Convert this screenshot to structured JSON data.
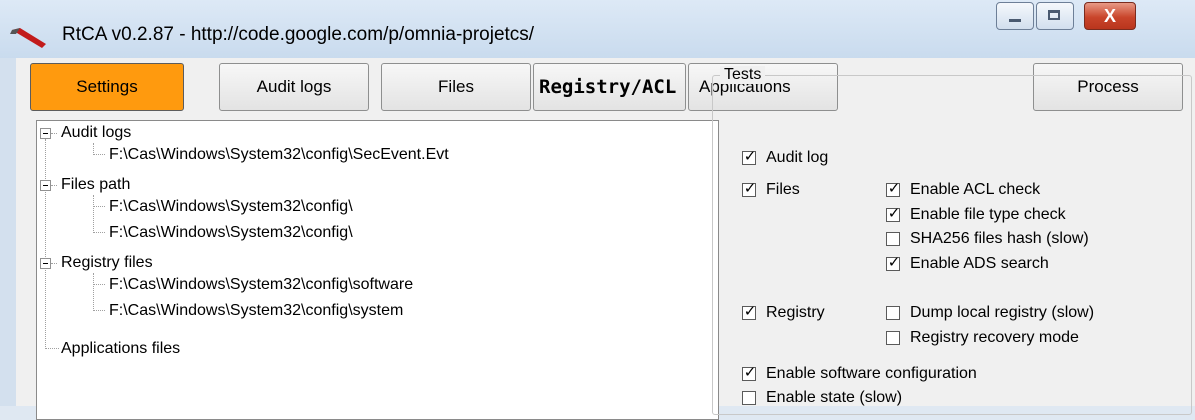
{
  "window": {
    "title": "RtCA v0.2.87 - http://code.google.com/p/omnia-projetcs/",
    "close_glyph": "X"
  },
  "tabs": [
    {
      "label": "Settings",
      "active": true
    },
    {
      "label": "Audit logs",
      "active": false
    },
    {
      "label": "Files",
      "active": false
    },
    {
      "label": "Registry/ACL",
      "active": false
    },
    {
      "label": "Applications",
      "active": false
    },
    {
      "label": "Process",
      "active": false
    }
  ],
  "tree": {
    "audit_logs": {
      "label": "Audit logs",
      "children": [
        "F:\\Cas\\Windows\\System32\\config\\SecEvent.Evt"
      ]
    },
    "files_path": {
      "label": "Files path",
      "children": [
        "F:\\Cas\\Windows\\System32\\config\\",
        "F:\\Cas\\Windows\\System32\\config\\"
      ]
    },
    "registry_files": {
      "label": "Registry files",
      "children": [
        "F:\\Cas\\Windows\\System32\\config\\software",
        "F:\\Cas\\Windows\\System32\\config\\system"
      ]
    },
    "applications_files": {
      "label": "Applications files"
    }
  },
  "tests": {
    "legend": "Tests",
    "audit_log": {
      "label": "Audit log",
      "checked": true
    },
    "files": {
      "label": "Files",
      "checked": true
    },
    "enable_acl_check": {
      "label": "Enable ACL check",
      "checked": true
    },
    "enable_file_type_check": {
      "label": "Enable file type check",
      "checked": true
    },
    "sha256_files_hash": {
      "label": "SHA256 files hash (slow)",
      "checked": false
    },
    "enable_ads_search": {
      "label": "Enable ADS search",
      "checked": true
    },
    "registry": {
      "label": "Registry",
      "checked": true
    },
    "dump_local_registry": {
      "label": "Dump local registry (slow)",
      "checked": false
    },
    "registry_recovery_mode": {
      "label": "Registry recovery mode",
      "checked": false
    },
    "enable_software_configuration": {
      "label": "Enable software configuration",
      "checked": true
    },
    "enable_state": {
      "label": "Enable state (slow)",
      "checked": false
    }
  },
  "colors": {
    "active_tab": "#ff9a0e",
    "title_bar": "#c9dbee",
    "close_button": "#c9452b"
  },
  "icons": {
    "app": "pen-icon",
    "minimize": "minimize-icon",
    "maximize": "maximize-icon",
    "close": "close-icon"
  }
}
